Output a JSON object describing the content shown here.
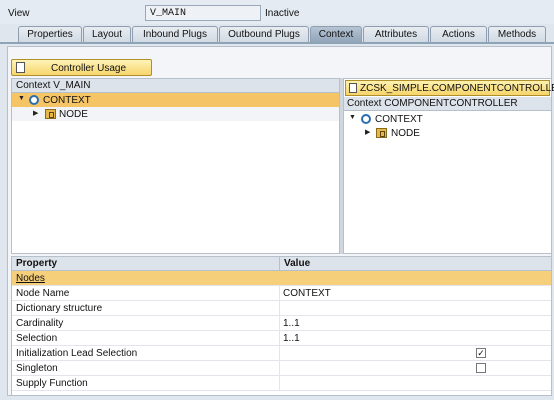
{
  "view": {
    "label": "View",
    "name": "V_MAIN",
    "status": "Inactive"
  },
  "tabs": [
    {
      "label": "Properties"
    },
    {
      "label": "Layout"
    },
    {
      "label": "Inbound Plugs"
    },
    {
      "label": "Outbound Plugs"
    },
    {
      "label": "Context"
    },
    {
      "label": "Attributes"
    },
    {
      "label": "Actions"
    },
    {
      "label": "Methods"
    }
  ],
  "controller_usage_button": "Controller Usage",
  "left_context": {
    "title": "Context V_MAIN",
    "root": "CONTEXT",
    "child": "NODE"
  },
  "right_context": {
    "component_button": "ZCSK_SIMPLE.COMPONENTCONTROLLER",
    "title": "Context COMPONENTCONTROLLER",
    "root": "CONTEXT",
    "child": "NODE"
  },
  "properties": {
    "col_property": "Property",
    "col_value": "Value",
    "group": "Nodes",
    "rows": [
      {
        "key": "Node Name",
        "value": "CONTEXT"
      },
      {
        "key": "Dictionary structure",
        "value": ""
      },
      {
        "key": "Cardinality",
        "value": "1..1"
      },
      {
        "key": "Selection",
        "value": "1..1"
      },
      {
        "key": "Initialization Lead Selection",
        "value": "",
        "checked": true
      },
      {
        "key": "Singleton",
        "value": "",
        "checked": false
      },
      {
        "key": "Supply Function",
        "value": ""
      }
    ]
  }
}
